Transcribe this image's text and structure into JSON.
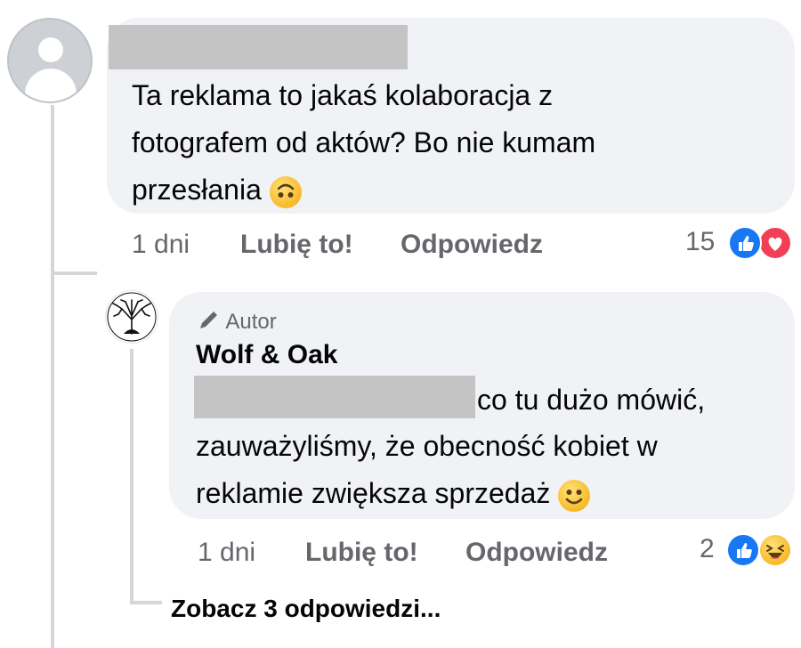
{
  "main_comment": {
    "text": "Ta reklama to jakaś kolaboracja z\nfotografem od aktów? Bo nie kumam\nprzesłania",
    "emoji": "upside-down-face-emoji",
    "time": "1 dni",
    "like_label": "Lubię to!",
    "reply_label": "Odpowiedz",
    "reaction_count": "15",
    "reactions": [
      "like-icon",
      "love-icon"
    ]
  },
  "reply_comment": {
    "badge": "Autor",
    "badge_icon": "pencil-icon",
    "author": "Wolf & Oak",
    "text_first_line": "co tu dużo mówić,",
    "text_rest": "zauważyliśmy, że obecność kobiet w\nreklamie zwiększa sprzedaż",
    "emoji": "smiling-face-emoji",
    "time": "1 dni",
    "like_label": "Lubię to!",
    "reply_label": "Odpowiedz",
    "reaction_count": "2",
    "reactions": [
      "like-icon",
      "haha-icon"
    ]
  },
  "see_replies": "Zobacz 3 odpowiedzi...",
  "colors": {
    "bubble": "#f0f2f5",
    "meta_text": "#65676b",
    "like_blue": "#1877f2",
    "love_red": "#f33e58",
    "redaction": "#c4c4c4"
  }
}
